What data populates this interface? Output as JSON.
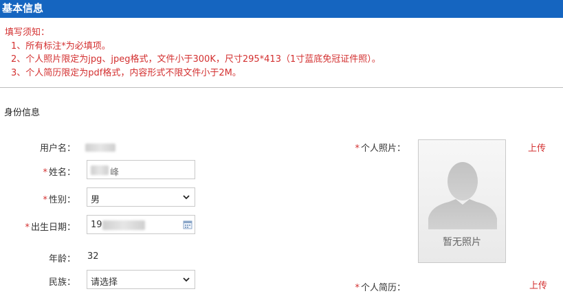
{
  "header": {
    "title": "基本信息"
  },
  "notice": {
    "heading": "填写须知：",
    "items": [
      "1、所有标注*为必填项。",
      "2、个人照片限定为jpg、jpeg格式，文件小于300K，尺寸295*413（1寸蓝底免冠证件照）。",
      "3、个人简历限定为pdf格式，内容形式不限文件小于2M。"
    ]
  },
  "section": {
    "title": "身份信息"
  },
  "required_mark": "*",
  "form": {
    "username_label": "用户名：",
    "name_label": "姓名：",
    "name_value_visible": "峰",
    "gender_label": "性别：",
    "gender_value": "男",
    "birth_label": "出生日期：",
    "birth_value_visible": "19",
    "age_label": "年龄：",
    "age_value": "32",
    "ethnicity_label": "民族：",
    "ethnicity_value": "请选择"
  },
  "photo": {
    "label": "个人照片：",
    "placeholder": "暂无照片",
    "upload_label": "上传"
  },
  "resume": {
    "label": "个人简历：",
    "upload_label": "上传"
  },
  "colors": {
    "header_bg": "#1565c0",
    "notice": "#d32f2f",
    "required": "#d32f2f"
  }
}
